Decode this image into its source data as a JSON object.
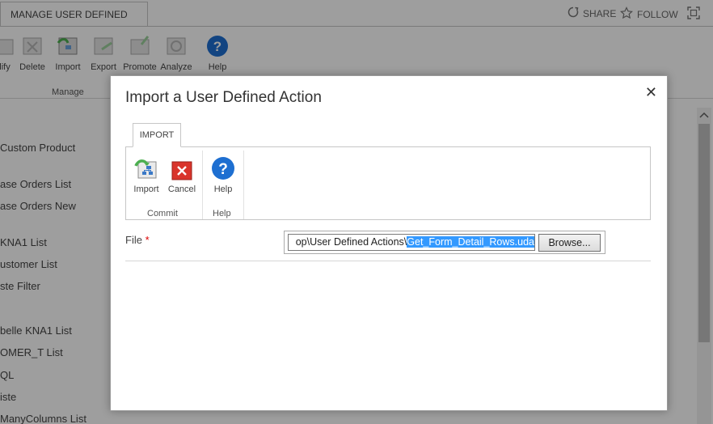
{
  "ribbon": {
    "tab_label": "MANAGE USER DEFINED ACTIONS",
    "share_label": "SHARE",
    "follow_label": "FOLLOW",
    "buttons": [
      {
        "label": "lify",
        "icon": "modify-icon"
      },
      {
        "label": "Delete",
        "icon": "delete-icon"
      },
      {
        "label": "Import",
        "icon": "import-icon"
      },
      {
        "label": "Export",
        "icon": "export-icon"
      },
      {
        "label": "Promote",
        "icon": "promote-icon"
      },
      {
        "label": "Analyze",
        "icon": "analyze-icon"
      },
      {
        "label": "Help",
        "icon": "help-icon"
      }
    ],
    "group_label": "Manage"
  },
  "sidebar": {
    "items": [
      "Custom Product",
      "ase Orders List",
      "ase Orders New",
      "KNA1 List",
      "ustomer List",
      "ste Filter",
      "belle KNA1 List",
      "OMER_T List",
      "QL",
      "iste",
      "ManyColumns List"
    ]
  },
  "dialog": {
    "title": "Import a User Defined Action",
    "close_symbol": "✕",
    "tab_label": "IMPORT",
    "buttons": {
      "import": "Import",
      "cancel": "Cancel",
      "help": "Help"
    },
    "groups": {
      "commit": "Commit",
      "help": "Help"
    },
    "file": {
      "label": "File",
      "required_marker": "*",
      "path_prefix": "op\\User Defined Actions\\",
      "path_selected": "Get_Form_Detail_Rows.uda",
      "browse_label": "Browse..."
    }
  },
  "colors": {
    "selection": "#3399ff",
    "required": "#dd0000",
    "help_blue": "#1e6fd1",
    "cancel_red": "#d9342b"
  }
}
